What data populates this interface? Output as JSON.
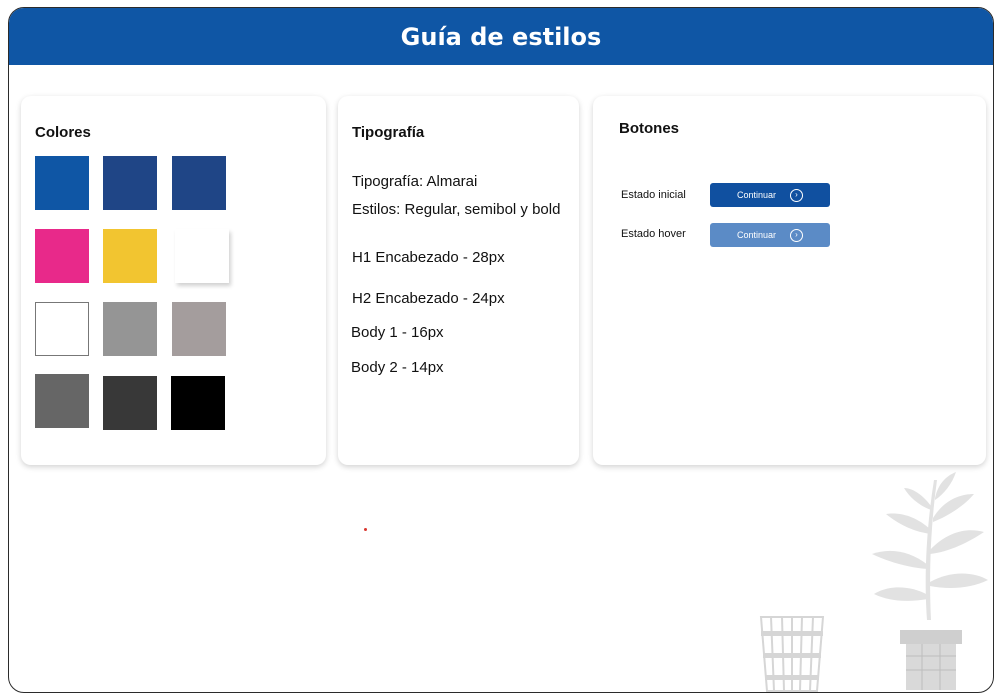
{
  "header": {
    "title": "Guía de estilos"
  },
  "colors_card": {
    "title": "Colores",
    "swatches": [
      "#0f56a5",
      "#1f4586",
      "#1f4586",
      "#e8298a",
      "#f2c530",
      "#ffffff",
      "#ffffff",
      "#959595",
      "#a49d9d",
      "#666666",
      "#383838",
      "#000000"
    ]
  },
  "typography_card": {
    "title": "Tipografía",
    "font_line": "Tipografía: Almarai",
    "styles_line": "Estilos: Regular, semibol y bold",
    "h1_line": "H1 Encabezado - 28px",
    "h2_line": "H2 Encabezado - 24px",
    "body1_line": "Body 1 - 16px",
    "body2_line": "Body 2 - 14px"
  },
  "buttons_card": {
    "title": "Botones",
    "initial_state_label": "Estado inicial",
    "hover_state_label": "Estado hover",
    "button_label": "Continuar",
    "button_color": "#1050a0",
    "button_hover_color": "#5b8bc6",
    "arrow_icon": "chevron-right-circle-icon"
  }
}
